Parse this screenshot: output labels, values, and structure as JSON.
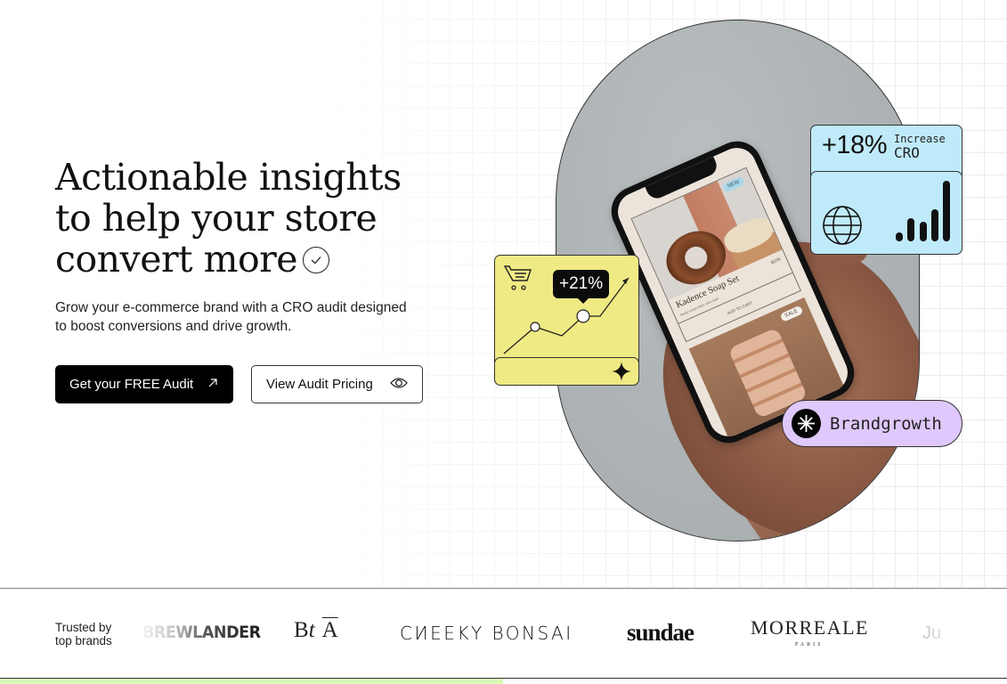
{
  "hero": {
    "title_lines": [
      "Actionable insights",
      "to help your store",
      "convert more"
    ],
    "title_icon": "check-circle-icon",
    "subtitle": "Grow your e-commerce brand with a CRO audit designed to boost conversions and drive growth.",
    "primary_button": {
      "label": "Get your FREE Audit",
      "icon": "arrow-up-right-icon"
    },
    "secondary_button": {
      "label": "View Audit Pricing",
      "icon": "eye-icon"
    }
  },
  "visual": {
    "phone": {
      "product_badge_new": "NEW",
      "product_title": "Kadence Soap Set",
      "product_price": "$104",
      "product_description": "Body smart daily skin care",
      "add_to_cart": "ADD TO CART",
      "product_badge_sale": "SALE"
    },
    "conversion_card": {
      "icon": "shopping-cart-icon",
      "value": "+21%",
      "footer_icon": "sparkle-icon",
      "background": "#f0ea84"
    },
    "cro_card": {
      "value": "+18%",
      "label_line1": "Increase",
      "label_line2": "CRO",
      "icon": "globe-icon",
      "chart_icon": "signal-bars-icon",
      "background": "#bfeafa"
    },
    "brand_badge": {
      "icon": "asterisk-icon",
      "label": "Brandgrowth",
      "background": "#dfc8fb"
    }
  },
  "logos": {
    "trusted_line1": "Trusted by",
    "trusted_line2": "top brands",
    "items": [
      {
        "name": "BREWLANDER",
        "text": "BREWLANDER"
      },
      {
        "name": "BtA",
        "text_b": "Bt",
        "text_a": "A"
      },
      {
        "name": "CHEEKY BONSAI",
        "text": "CИEEKY BONSAI"
      },
      {
        "name": "sundae",
        "text": "sundae"
      },
      {
        "name": "MORREALE PARIS",
        "text": "MORREALE",
        "subtext": "PARIS"
      },
      {
        "name": "Ju",
        "text": "Ju"
      }
    ]
  },
  "colors": {
    "accent_green": "#d8fbb7",
    "primary_button_bg": "#000000"
  }
}
